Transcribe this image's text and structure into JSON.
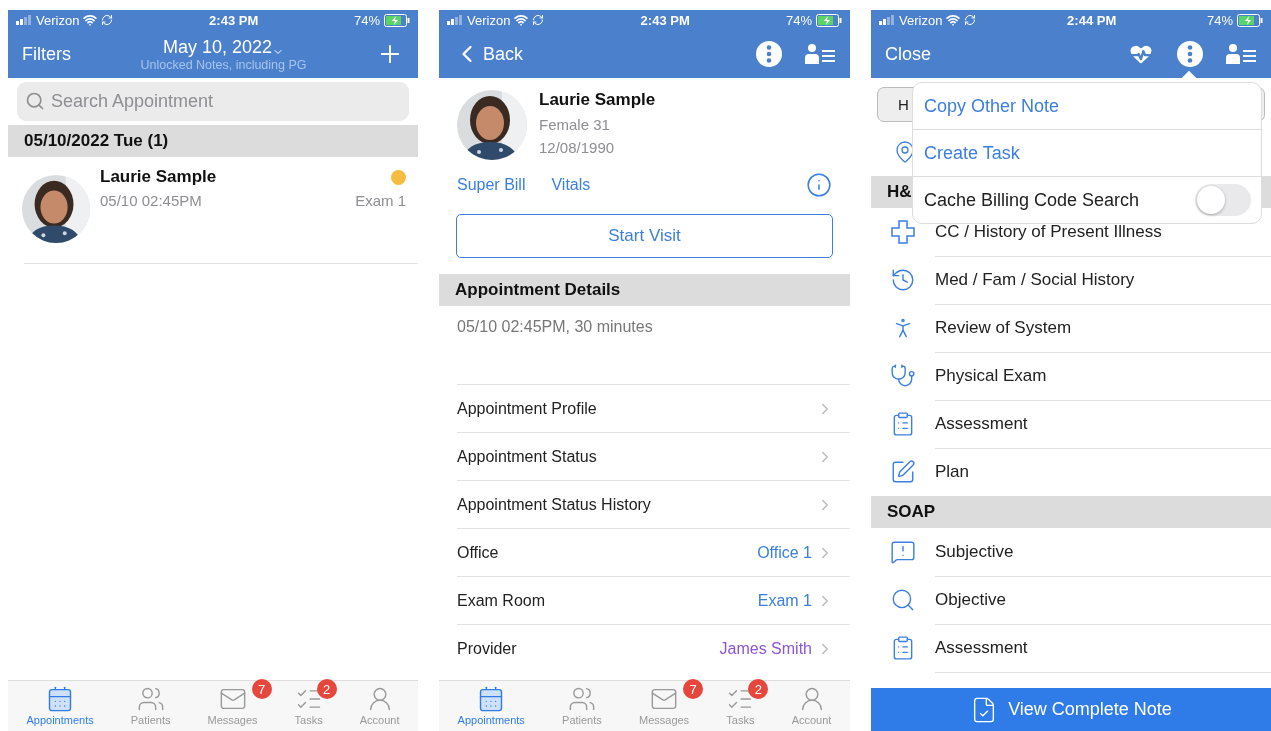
{
  "appointments_screen": {
    "status_bar": {
      "carrier": "Verizon",
      "time": "2:43 PM",
      "battery": "74%"
    },
    "nav": {
      "left": "Filters",
      "title": "May 10, 2022",
      "subtitle": "Unlocked Notes, including PG"
    },
    "search": {
      "placeholder": "Search Appointment"
    },
    "section": "05/10/2022 Tue (1)",
    "appointments": [
      {
        "name": "Laurie Sample",
        "time": "05/10 02:45PM",
        "room": "Exam 1",
        "color": "#f4bd3f"
      }
    ],
    "tab_bar": [
      {
        "label": "Appointments",
        "selected": true
      },
      {
        "label": "Patients",
        "selected": false
      },
      {
        "label": "Messages",
        "badge": "7",
        "selected": false
      },
      {
        "label": "Tasks",
        "badge": "2",
        "selected": false
      },
      {
        "label": "Account",
        "selected": false
      }
    ]
  },
  "appointment_screen": {
    "status_bar": {
      "carrier": "Verizon",
      "time": "2:43 PM",
      "battery": "74%"
    },
    "nav": {
      "back": "Back"
    },
    "patient": {
      "name": "Laurie Sample",
      "gender_age": "Female 31",
      "birth_date": "12/08/1990"
    },
    "links": [
      "Super Bill",
      "Vitals"
    ],
    "start_button": "Start Visit",
    "section": "Appointment Details",
    "details": "05/10 02:45PM, 30 minutes",
    "rows": [
      {
        "label": "Appointment Profile"
      },
      {
        "label": "Appointment Status"
      },
      {
        "label": "Appointment Status History"
      },
      {
        "label": "Office",
        "value": "Office 1",
        "color": "#3b7fe0"
      },
      {
        "label": "Exam Room",
        "value": "Exam 1",
        "color": "#3b7fe0"
      },
      {
        "label": "Provider",
        "value": "James Smith",
        "color": "#8a55d6"
      }
    ],
    "tab_bar": [
      {
        "label": "Appointments",
        "selected": true
      },
      {
        "label": "Patients",
        "selected": false
      },
      {
        "label": "Messages",
        "badge": "7",
        "selected": false
      },
      {
        "label": "Tasks",
        "badge": "2",
        "selected": false
      },
      {
        "label": "Account",
        "selected": false
      }
    ]
  },
  "note_screen": {
    "status_bar": {
      "carrier": "Verizon",
      "time": "2:44 PM",
      "battery": "74%"
    },
    "nav": {
      "left": "Close"
    },
    "segment": "H",
    "sections": [
      {
        "title": "H&",
        "items": [
          "CC / History of Present Illness",
          "Med / Fam / Social History",
          "Review of System",
          "Physical Exam",
          "Assessment",
          "Plan"
        ]
      },
      {
        "title": "SOAP",
        "items": [
          "Subjective",
          "Objective",
          "Assessment"
        ]
      }
    ],
    "button": "View Complete Note",
    "menu": [
      {
        "kind": "action",
        "label": "Copy Other Note"
      },
      {
        "kind": "action",
        "label": "Create Task"
      },
      {
        "kind": "toggle",
        "label": "Cache Billing Code Search",
        "on": false
      }
    ]
  }
}
